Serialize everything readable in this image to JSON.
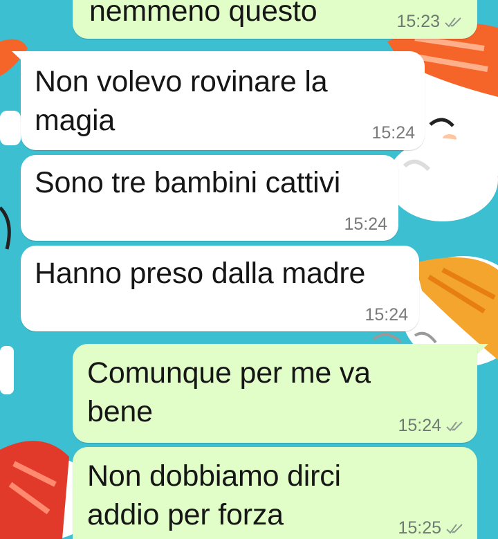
{
  "chat": {
    "messages": [
      {
        "text_lines": [
          "nemmeno questo"
        ],
        "time": "15:23",
        "direction": "out",
        "status": "delivered"
      },
      {
        "text_lines": [
          "Non volevo rovinare la",
          "magia"
        ],
        "time": "15:24",
        "direction": "in"
      },
      {
        "text_lines": [
          "Sono tre bambini cattivi"
        ],
        "time": "15:24",
        "direction": "in"
      },
      {
        "text_lines": [
          "Hanno preso dalla madre"
        ],
        "time": "15:24",
        "direction": "in"
      },
      {
        "text_lines": [
          "Comunque per me va",
          "bene"
        ],
        "time": "15:24",
        "direction": "out",
        "status": "delivered"
      },
      {
        "text_lines": [
          "Non dobbiamo dirci",
          "addio per forza"
        ],
        "time": "15:25",
        "direction": "out",
        "status": "delivered"
      }
    ]
  },
  "theme": {
    "wallpaper": "#3cbfd0",
    "incoming_bubble": "#ffffff",
    "outgoing_bubble": "#e1fec8",
    "tick_color": "#8c9b8f",
    "wallpaper_motif": "sushi-pattern"
  }
}
